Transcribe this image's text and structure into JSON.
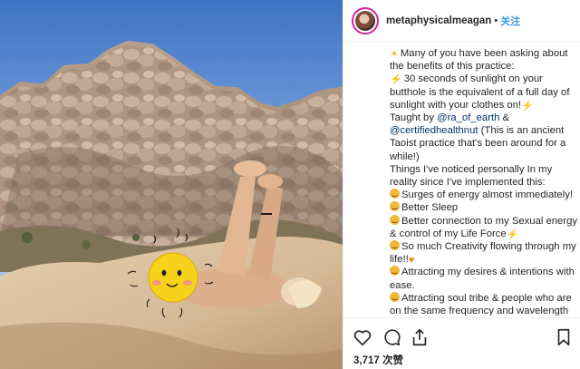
{
  "post": {
    "username": "metaphysicalmeagan",
    "separator": "•",
    "follow_label": "关注",
    "caption_lines": [
      {
        "icon": "sun-icon",
        "text": "Many of you have been asking about"
      },
      {
        "icon": "",
        "text": "the benefits of this practice:"
      },
      {
        "icon": "lightning-icon",
        "text": "30 seconds of sunlight on your"
      },
      {
        "icon": "",
        "text": "butthole is the equivalent of a full day of"
      },
      {
        "icon": "",
        "text": "sunlight with your clothes on!",
        "trail_icon": "lightning-icon"
      },
      {
        "icon": "",
        "text": "Taught by ",
        "mention": "@ra_of_earth",
        "after": " &"
      },
      {
        "icon": "",
        "mention": "@certifiedhealthnut",
        "after": " (This is an ancient"
      },
      {
        "icon": "",
        "text": "Taoist practice that's been around for a"
      },
      {
        "icon": "",
        "text": "while!)"
      },
      {
        "icon": "",
        "text": "Things I've noticed personally In my"
      },
      {
        "icon": "",
        "text": "reality since I've implemented this:"
      },
      {
        "icon": "smile-icon",
        "text": "Surges of energy almost immediately!"
      },
      {
        "icon": "smile-icon",
        "text": "Better Sleep"
      },
      {
        "icon": "smile-icon",
        "text": "Better connection to my Sexual energy"
      },
      {
        "icon": "",
        "text": "& control of my Life Force",
        "trail_icon": "lightning-icon"
      },
      {
        "icon": "smile-icon",
        "text": "So much Creativity flowing through my"
      },
      {
        "icon": "",
        "text": "life!!",
        "trail_icon": "heart-icon"
      },
      {
        "icon": "smile-icon",
        "text": "Attracting my desires & intentions with"
      },
      {
        "icon": "",
        "text": "ease."
      },
      {
        "icon": "smile-icon",
        "text": "Attracting soul tribe & people who are"
      },
      {
        "icon": "",
        "text": "on the same frequency and wavelength"
      }
    ],
    "views": "3,717 次赞"
  },
  "colors": {
    "accent": "#3897f0",
    "text": "#262626",
    "mention": "#003569",
    "sky": "#4f86cf",
    "rock": "#c9b49c",
    "sun_sticker": "#f6d21a"
  },
  "icons": [
    "heart-outline-icon",
    "comment-icon",
    "share-icon",
    "bookmark-icon"
  ]
}
